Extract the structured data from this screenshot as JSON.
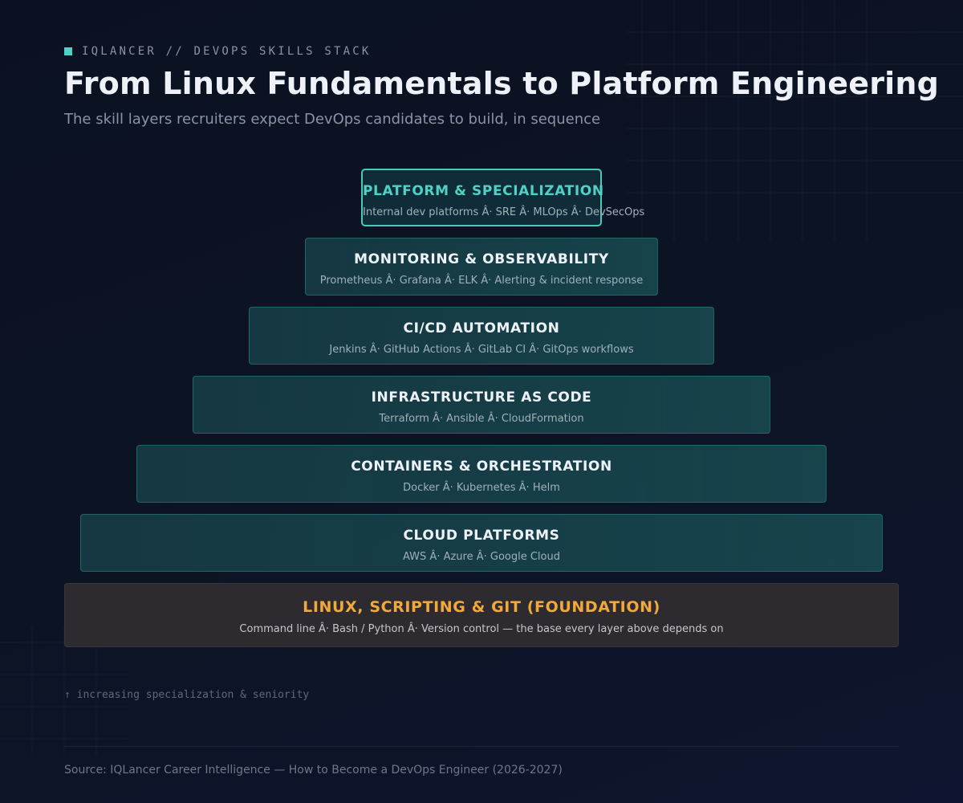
{
  "header": {
    "kicker": "IQLANCER // DEVOPS SKILLS STACK",
    "title": "From Linux Fundamentals to Platform Engineering",
    "subtitle": "The skill layers recruiters expect DevOps candidates to build, in sequence"
  },
  "layers": [
    {
      "name": "PLATFORM & SPECIALIZATION",
      "skills": "Internal dev platforms Â· SRE Â· MLOps Â· DevSecOps"
    },
    {
      "name": "MONITORING & OBSERVABILITY",
      "skills": "Prometheus Â· Grafana Â· ELK Â· Alerting & incident response"
    },
    {
      "name": "CI/CD AUTOMATION",
      "skills": "Jenkins Â· GitHub Actions Â· GitLab CI Â· GitOps workflows"
    },
    {
      "name": "INFRASTRUCTURE AS CODE",
      "skills": "Terraform Â· Ansible Â· CloudFormation"
    },
    {
      "name": "CONTAINERS & ORCHESTRATION",
      "skills": "Docker Â· Kubernetes Â· Helm"
    },
    {
      "name": "CLOUD PLATFORMS",
      "skills": "AWS Â· Azure Â· Google Cloud"
    },
    {
      "name": "LINUX, SCRIPTING & GIT (FOUNDATION)",
      "skills": "Command line Â· Bash / Python Â· Version control — the base every layer above depends on"
    }
  ],
  "axis_note": "↑ increasing specialization & seniority",
  "footer": {
    "source": "Source: IQLancer Career Intelligence — How to Become a DevOps Engineer (2026-2027)"
  },
  "colors": {
    "accent_teal": "#4fd1c5",
    "foundation_orange": "#f2a93b",
    "background": "#0b1120"
  }
}
